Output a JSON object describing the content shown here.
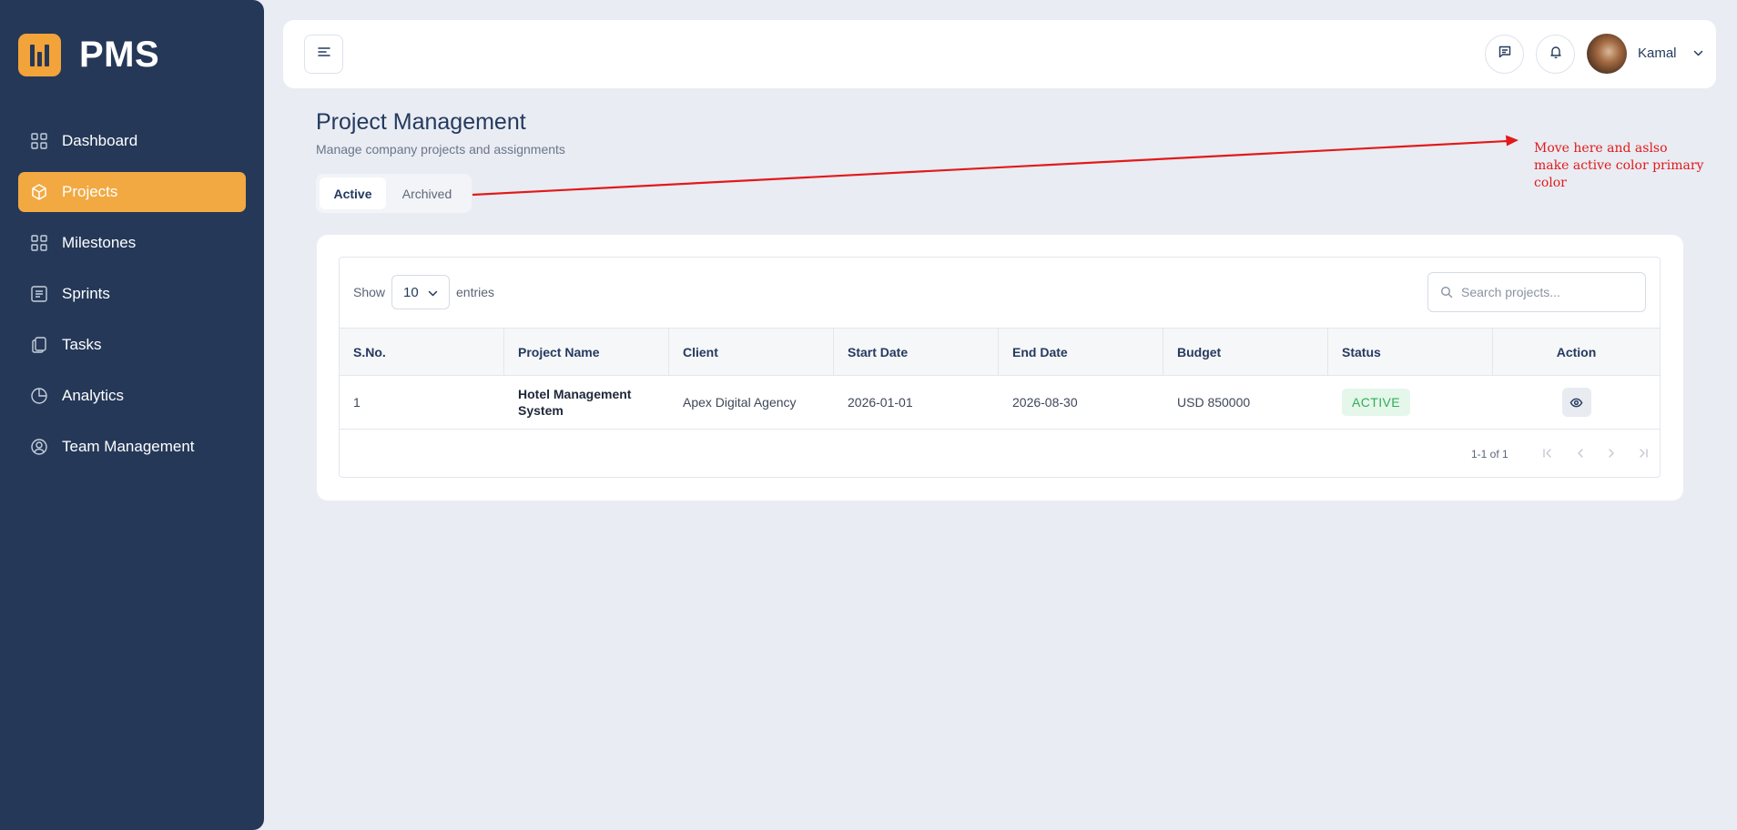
{
  "app": {
    "name": "PMS"
  },
  "sidebar": {
    "items": [
      {
        "label": "Dashboard",
        "icon": "grid-icon",
        "active": false
      },
      {
        "label": "Projects",
        "icon": "cube-icon",
        "active": true
      },
      {
        "label": "Milestones",
        "icon": "grid-icon",
        "active": false
      },
      {
        "label": "Sprints",
        "icon": "list-box-icon",
        "active": false
      },
      {
        "label": "Tasks",
        "icon": "copy-icon",
        "active": false
      },
      {
        "label": "Analytics",
        "icon": "pie-chart-icon",
        "active": false
      },
      {
        "label": "Team Management",
        "icon": "user-circle-icon",
        "active": false
      }
    ]
  },
  "header": {
    "user_name": "Kamal"
  },
  "page": {
    "title": "Project Management",
    "subtitle": "Manage company projects and assignments"
  },
  "tabs": [
    {
      "label": "Active",
      "active": true
    },
    {
      "label": "Archived",
      "active": false
    }
  ],
  "annotation": {
    "line1": "Move here and aslso",
    "line2": "make active color primary color",
    "color": "#e11a1a"
  },
  "table": {
    "show_label": "Show",
    "entries_value": "10",
    "entries_label": "entries",
    "search_placeholder": "Search projects...",
    "columns": [
      "S.No.",
      "Project Name",
      "Client",
      "Start Date",
      "End Date",
      "Budget",
      "Status",
      "Action"
    ],
    "rows": [
      {
        "sno": "1",
        "project_name": "Hotel Management System",
        "client": "Apex Digital Agency",
        "start_date": "2026-01-01",
        "end_date": "2026-08-30",
        "budget": "USD 850000",
        "status": "ACTIVE"
      }
    ],
    "pagination": "1-1 of 1"
  },
  "colors": {
    "sidebar_bg": "#253858",
    "accent": "#f2a942",
    "status_active_bg": "#e5f6ea",
    "status_active_text": "#2fae58"
  }
}
